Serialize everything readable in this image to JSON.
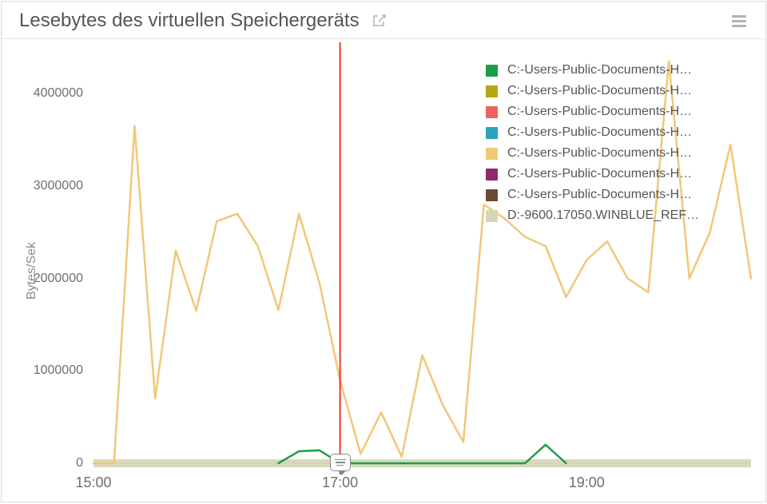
{
  "header": {
    "title": "Lesebytes des virtuellen Speichergeräts"
  },
  "chart_data": {
    "type": "line",
    "title": "Lesebytes des virtuellen Speichergeräts",
    "xlabel": "",
    "ylabel": "Bytes/Sek",
    "ylim": [
      0,
      4400000
    ],
    "y_ticks": [
      0,
      1000000,
      2000000,
      3000000,
      4000000
    ],
    "x_ticks": [
      "15:00",
      "17:00",
      "19:00"
    ],
    "x_range": [
      "15:00",
      "20:20"
    ],
    "marker_x": "17:00",
    "legend_position": "top-right",
    "series": [
      {
        "name": "C:-Users-Public-Documents-H…",
        "color": "#1b9e48",
        "x": [
          "16:30",
          "16:40",
          "16:50",
          "17:00",
          "17:10",
          "18:30",
          "18:40",
          "18:50"
        ],
        "values": [
          0,
          130000,
          140000,
          0,
          0,
          0,
          200000,
          0
        ]
      },
      {
        "name": "C:-Users-Public-Documents-H…",
        "color": "#b3a813",
        "x": [],
        "values": []
      },
      {
        "name": "C:-Users-Public-Documents-H…",
        "color": "#f0615f",
        "x": [],
        "values": []
      },
      {
        "name": "C:-Users-Public-Documents-H…",
        "color": "#2aa3bd",
        "x": [],
        "values": []
      },
      {
        "name": "C:-Users-Public-Documents-H…",
        "color": "#f2c777",
        "x": [
          "15:00",
          "15:10",
          "15:20",
          "15:30",
          "15:40",
          "15:50",
          "16:00",
          "16:10",
          "16:20",
          "16:30",
          "16:40",
          "16:50",
          "17:00",
          "17:10",
          "17:20",
          "17:30",
          "17:40",
          "17:50",
          "18:00",
          "18:10",
          "18:20",
          "18:30",
          "18:40",
          "18:50",
          "19:00",
          "19:10",
          "19:20",
          "19:30",
          "19:40",
          "19:50",
          "20:00",
          "20:10",
          "20:20"
        ],
        "values": [
          0,
          0,
          3650000,
          700000,
          2300000,
          1650000,
          2620000,
          2700000,
          2350000,
          1660000,
          2700000,
          1950000,
          900000,
          100000,
          550000,
          70000,
          1170000,
          630000,
          230000,
          2800000,
          2650000,
          2450000,
          2350000,
          1800000,
          2200000,
          2400000,
          2000000,
          1850000,
          4350000,
          2000000,
          2500000,
          3450000,
          2000000
        ]
      },
      {
        "name": "C:-Users-Public-Documents-H…",
        "color": "#8e2a6d",
        "x": [],
        "values": []
      },
      {
        "name": "C:-Users-Public-Documents-H…",
        "color": "#6b4a35",
        "x": [],
        "values": []
      },
      {
        "name": "D:-9600.17050.WINBLUE_REF…",
        "color": "#d6d4b6",
        "x": [
          "15:00",
          "20:20"
        ],
        "values": [
          0,
          0
        ]
      }
    ]
  }
}
